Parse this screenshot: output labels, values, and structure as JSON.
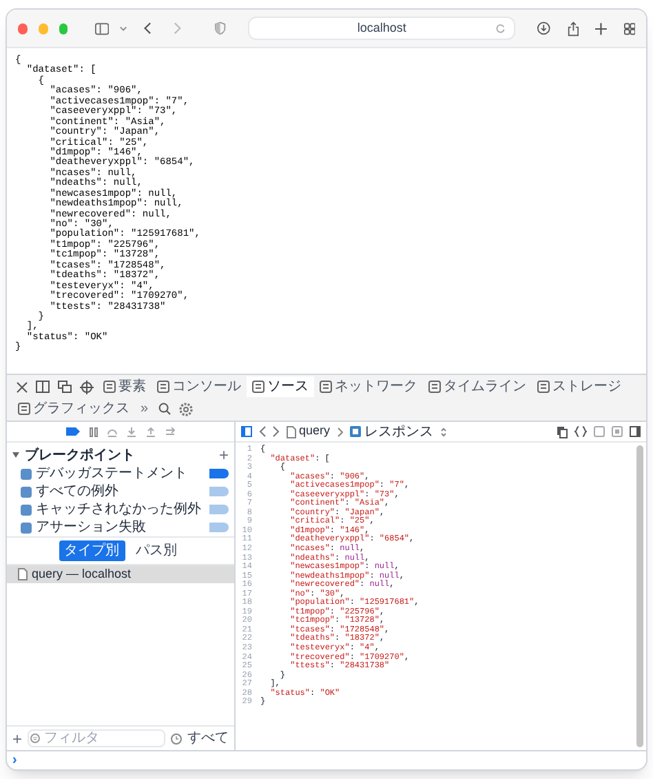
{
  "window": {
    "address": "localhost"
  },
  "page_lines": [
    "{",
    "  \"dataset\": [",
    "    {",
    "      \"acases\": \"906\",",
    "      \"activecases1mpop\": \"7\",",
    "      \"caseeveryxppl\": \"73\",",
    "      \"continent\": \"Asia\",",
    "      \"country\": \"Japan\",",
    "      \"critical\": \"25\",",
    "      \"d1mpop\": \"146\",",
    "      \"deatheveryxppl\": \"6854\",",
    "      \"ncases\": null,",
    "      \"ndeaths\": null,",
    "      \"newcases1mpop\": null,",
    "      \"newdeaths1mpop\": null,",
    "      \"newrecovered\": null,",
    "      \"no\": \"30\",",
    "      \"population\": \"125917681\",",
    "      \"t1mpop\": \"225796\",",
    "      \"tc1mpop\": \"13728\",",
    "      \"tcases\": \"1728548\",",
    "      \"tdeaths\": \"18372\",",
    "      \"testeveryx\": \"4\",",
    "      \"trecovered\": \"1709270\",",
    "      \"ttests\": \"28431738\"",
    "    }",
    "  ],",
    "  \"status\": \"OK\"",
    "}"
  ],
  "devtools": {
    "tabs": [
      {
        "label": "要素",
        "selected": false
      },
      {
        "label": "コンソール",
        "selected": false
      },
      {
        "label": "ソース",
        "selected": true
      },
      {
        "label": "ネットワーク",
        "selected": false
      },
      {
        "label": "タイムライン",
        "selected": false
      },
      {
        "label": "ストレージ",
        "selected": false
      },
      {
        "label": "グラフィックス",
        "selected": false
      }
    ],
    "more_tabs": "»",
    "breakpoints": {
      "title": "ブレークポイント",
      "add": "+",
      "items": [
        {
          "label": "デバッガステートメント",
          "enabled": true
        },
        {
          "label": "すべての例外",
          "enabled": false
        },
        {
          "label": "キャッチされなかった例外",
          "enabled": false
        },
        {
          "label": "アサーション失敗",
          "enabled": false
        }
      ]
    },
    "group_by": [
      {
        "label": "タイプ別",
        "selected": true
      },
      {
        "label": "パス別",
        "selected": false
      }
    ],
    "resources": [
      {
        "label": "query — localhost",
        "selected": true
      }
    ],
    "filter": {
      "add": "+",
      "placeholder": "フィルタ",
      "scope": "すべて"
    },
    "breadcrumb": [
      "query",
      "レスポンス"
    ],
    "code_lines": [
      {
        "n": "1",
        "text": "{"
      },
      {
        "n": "2",
        "text": "  \"dataset\": ["
      },
      {
        "n": "3",
        "text": "    {"
      },
      {
        "n": "4",
        "text": "      \"acases\": \"906\","
      },
      {
        "n": "5",
        "text": "      \"activecases1mpop\": \"7\","
      },
      {
        "n": "6",
        "text": "      \"caseeveryxppl\": \"73\","
      },
      {
        "n": "7",
        "text": "      \"continent\": \"Asia\","
      },
      {
        "n": "8",
        "text": "      \"country\": \"Japan\","
      },
      {
        "n": "9",
        "text": "      \"critical\": \"25\","
      },
      {
        "n": "10",
        "text": "      \"d1mpop\": \"146\","
      },
      {
        "n": "11",
        "text": "      \"deatheveryxppl\": \"6854\","
      },
      {
        "n": "12",
        "text": "      \"ncases\": null,"
      },
      {
        "n": "13",
        "text": "      \"ndeaths\": null,"
      },
      {
        "n": "14",
        "text": "      \"newcases1mpop\": null,"
      },
      {
        "n": "15",
        "text": "      \"newdeaths1mpop\": null,"
      },
      {
        "n": "16",
        "text": "      \"newrecovered\": null,"
      },
      {
        "n": "17",
        "text": "      \"no\": \"30\","
      },
      {
        "n": "18",
        "text": "      \"population\": \"125917681\","
      },
      {
        "n": "19",
        "text": "      \"t1mpop\": \"225796\","
      },
      {
        "n": "20",
        "text": "      \"tc1mpop\": \"13728\","
      },
      {
        "n": "21",
        "text": "      \"tcases\": \"1728548\","
      },
      {
        "n": "22",
        "text": "      \"tdeaths\": \"18372\","
      },
      {
        "n": "23",
        "text": "      \"testeveryx\": \"4\","
      },
      {
        "n": "24",
        "text": "      \"trecovered\": \"1709270\","
      },
      {
        "n": "25",
        "text": "      \"ttests\": \"28431738\""
      },
      {
        "n": "26",
        "text": "    }"
      },
      {
        "n": "27",
        "text": "  ],"
      },
      {
        "n": "28",
        "text": "  \"status\": \"OK\""
      },
      {
        "n": "29",
        "text": "}"
      }
    ],
    "console_prompt": "›"
  }
}
